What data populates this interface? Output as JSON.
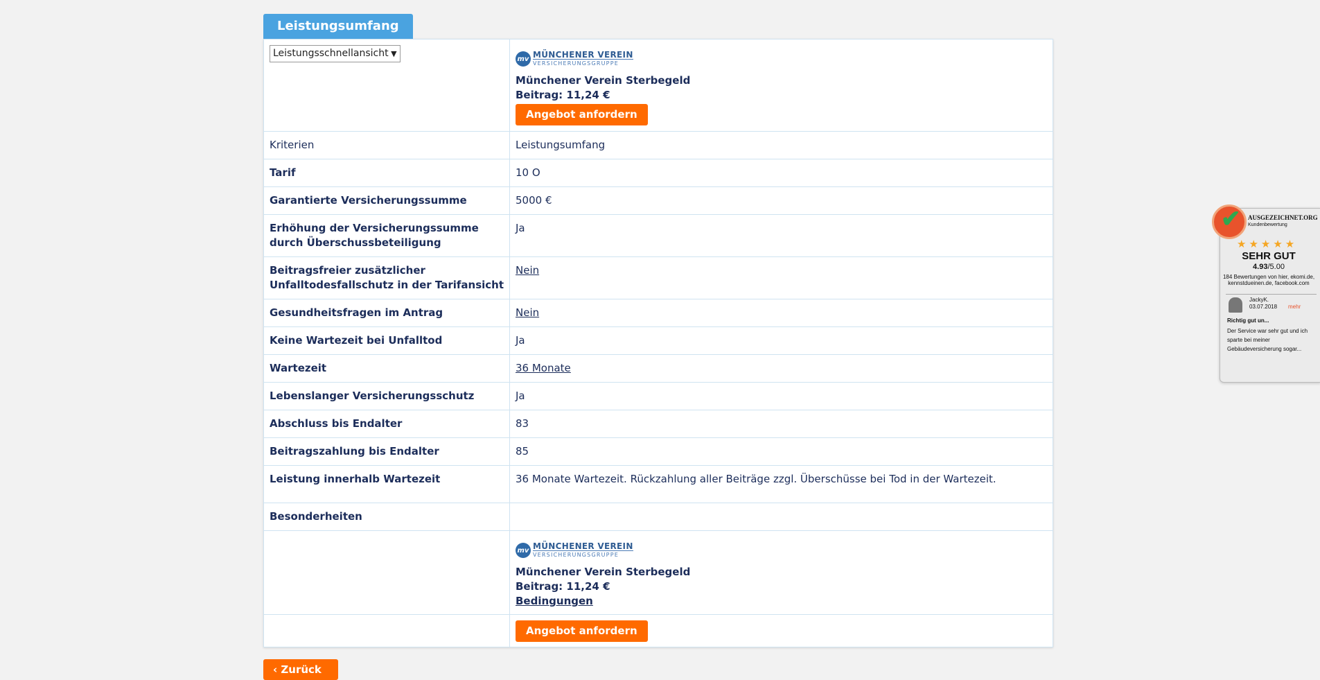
{
  "tab_title": "Leistungsumfang",
  "select": {
    "value": "Leistungsschnellansicht"
  },
  "product": {
    "logo_main": "MÜNCHENER VEREIN",
    "logo_sub": "VERSICHERUNGSGRUPPE",
    "logo_badge": "mv",
    "name": "Münchener Verein Sterbegeld",
    "premium": "Beitrag: 11,24 €",
    "cta": "Angebot anfordern",
    "conditions": "Bedingungen"
  },
  "header_row": {
    "left": "Kriterien",
    "right": "Leistungsumfang"
  },
  "rows": [
    {
      "label": "Tarif",
      "value": "10 O"
    },
    {
      "label": "Garantierte Versicherungssumme",
      "value": "5000 €"
    },
    {
      "label": "Erhöhung der Versicherungssumme durch Überschussbeteiligung",
      "value": "Ja"
    },
    {
      "label": "Beitragsfreier zusätzlicher Unfalltodesfallschutz in der Tarifansicht",
      "value": "Nein"
    },
    {
      "label": "Gesundheitsfragen im Antrag",
      "value": "Nein"
    },
    {
      "label": "Keine Wartezeit bei Unfalltod",
      "value": "Ja"
    },
    {
      "label": "Wartezeit",
      "value": "36 Monate"
    },
    {
      "label": "Lebenslanger Versicherungsschutz",
      "value": "Ja"
    },
    {
      "label": "Abschluss bis Endalter",
      "value": "83"
    },
    {
      "label": "Beitragszahlung bis Endalter",
      "value": "85"
    },
    {
      "label": "Leistung innerhalb Wartezeit",
      "value": "36 Monate Wartezeit. Rückzahlung aller Beiträge zzgl. Überschüsse bei Tod in der Wartezeit."
    },
    {
      "label": "Besonderheiten",
      "value": ""
    }
  ],
  "back_button": "Zurück",
  "widget": {
    "brand": "AUSGEZEICHNET.ORG",
    "subtitle": "Kundenbewertung",
    "stars": "★★★★★",
    "grade": "SEHR GUT",
    "score": "4.93",
    "score_max": "/5.00",
    "count": "184 Bewertungen von hier, ekomi.de, kennstdueinen.de, facebook.com",
    "user": "JackyK.",
    "date": "03.07.2018",
    "more": "mehr",
    "review_title": "Richtig gut un...",
    "review_text": "Der Service war sehr gut und ich sparte bei meiner Gebäudeversicherung sogar..."
  }
}
